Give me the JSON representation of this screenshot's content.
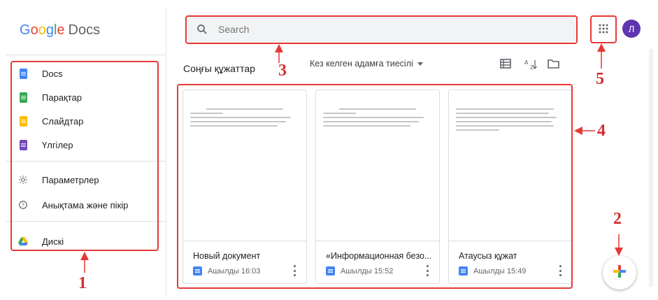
{
  "app": {
    "logo_google_letters": [
      "G",
      "o",
      "o",
      "g",
      "l",
      "e"
    ],
    "logo_product": "Docs"
  },
  "sidebar": {
    "items": [
      {
        "label": "Docs",
        "icon": "docs-icon",
        "color": "#4285f4"
      },
      {
        "label": "Парақтар",
        "icon": "sheets-icon",
        "color": "#34a853"
      },
      {
        "label": "Слайдтар",
        "icon": "slides-icon",
        "color": "#fbbc04"
      },
      {
        "label": "Үлгілер",
        "icon": "forms-icon",
        "color": "#7248b9"
      },
      {
        "label": "Параметрлер",
        "icon": "gear-icon"
      },
      {
        "label": "Анықтама және пікір",
        "icon": "help-icon"
      },
      {
        "label": "Дискі",
        "icon": "drive-icon"
      }
    ]
  },
  "search": {
    "placeholder": "Search"
  },
  "header": {
    "avatar_initial": "Л"
  },
  "main": {
    "section_title": "Соңғы құжаттар",
    "owner_filter": "Кез келген адамға тиесілі"
  },
  "documents": [
    {
      "title": "Новый документ",
      "meta": "Ашылды 16:03"
    },
    {
      "title": "«Информационная безо...",
      "meta": "Ашылды 15:52"
    },
    {
      "title": "Атаусыз құжат",
      "meta": "Ашылды 15:49"
    }
  ],
  "annotations": {
    "labels": [
      "1",
      "2",
      "3",
      "4",
      "5"
    ],
    "color": "#e53935"
  }
}
